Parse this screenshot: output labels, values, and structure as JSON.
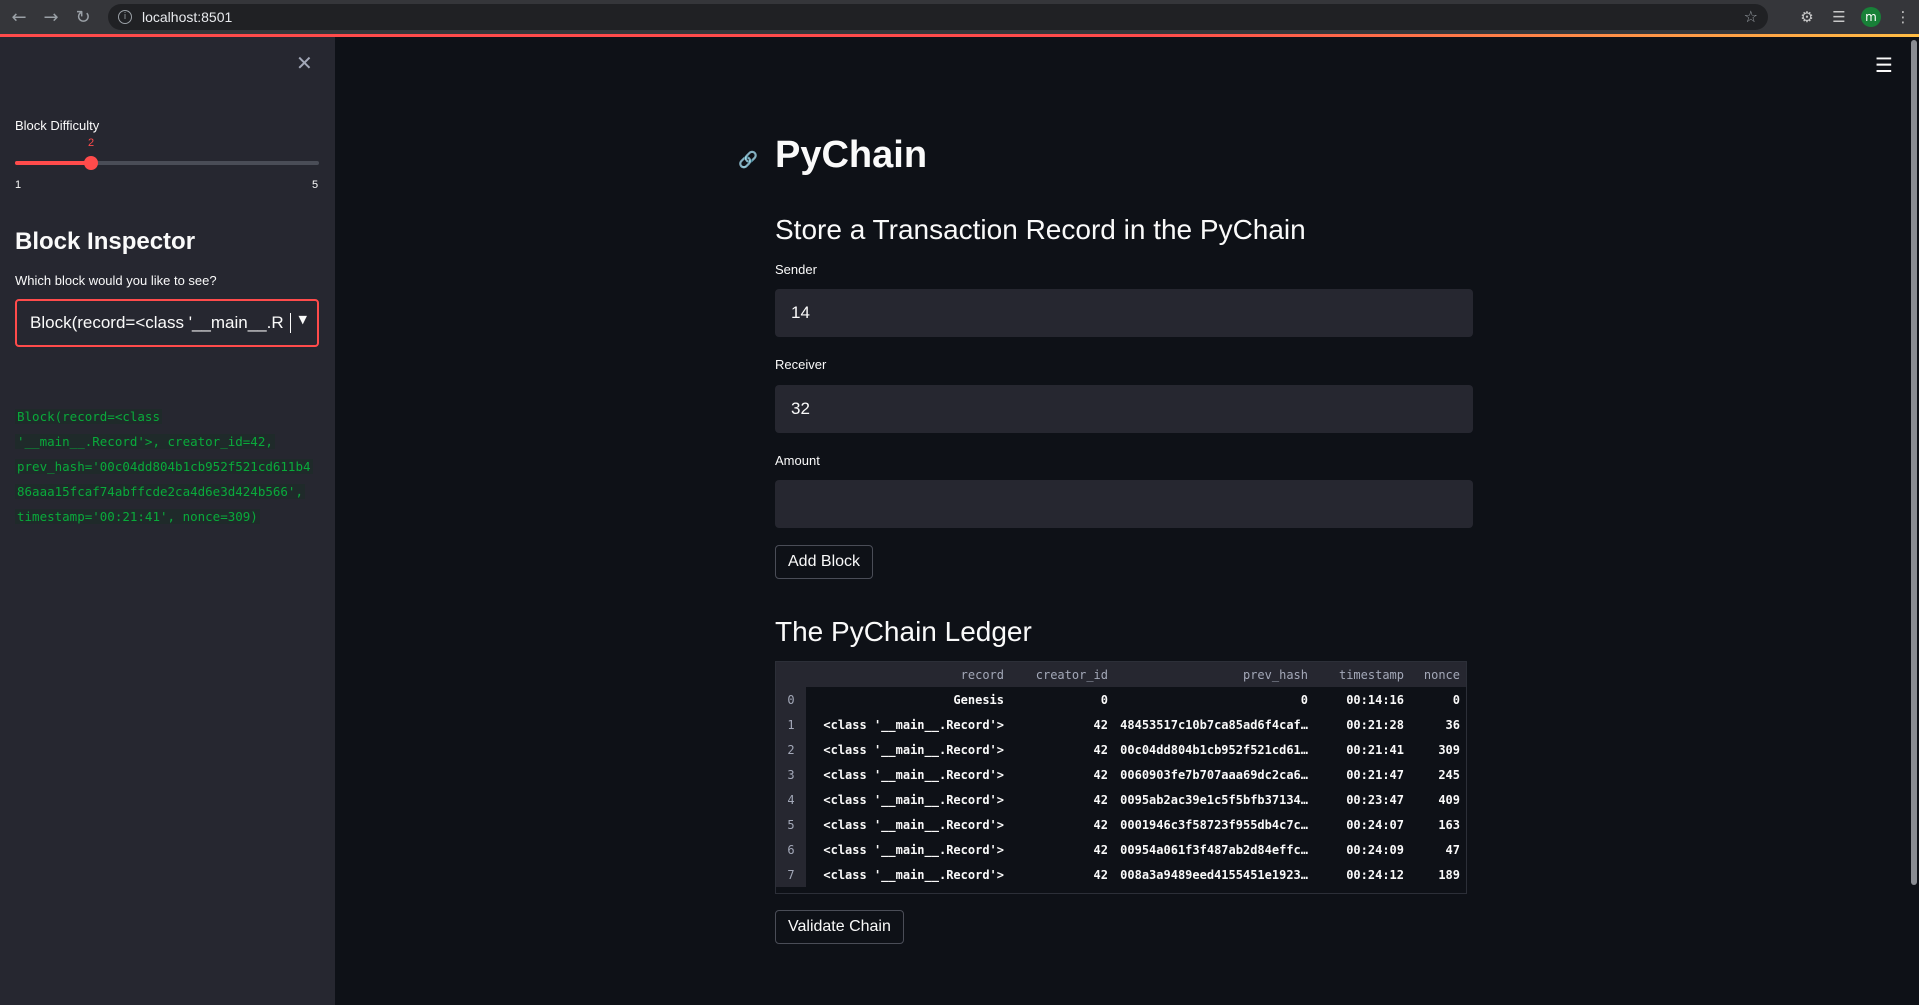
{
  "browser": {
    "url": "localhost:8501",
    "profile_initial": "m"
  },
  "sidebar": {
    "slider": {
      "label": "Block Difficulty",
      "value": "2",
      "min": "1",
      "max": "5",
      "fraction": 0.25
    },
    "heading": "Block Inspector",
    "select_label": "Which block would you like to see?",
    "select_value": "Block(record=<class '__main__.R...",
    "code_lines": [
      "Block(record=<class",
      "'__main__.Record'>, creator_id=42,",
      "prev_hash='00c04dd804b1cb952f521cd611b4",
      "86aaa15fcaf74abffcde2ca4d6e3d424b566',",
      "timestamp='00:21:41', nonce=309)"
    ]
  },
  "main": {
    "title": "PyChain",
    "form_heading": "Store a Transaction Record in the PyChain",
    "sender": {
      "label": "Sender",
      "value": "14"
    },
    "receiver": {
      "label": "Receiver",
      "value": "32"
    },
    "amount": {
      "label": "Amount",
      "value": ""
    },
    "add_block": "Add Block",
    "ledger_heading": "The PyChain Ledger",
    "validate": "Validate Chain"
  },
  "ledger": {
    "columns": [
      "record",
      "creator_id",
      "prev_hash",
      "timestamp",
      "nonce"
    ],
    "rows": [
      [
        "0",
        "Genesis",
        "0",
        "0",
        "00:14:16",
        "0"
      ],
      [
        "1",
        "<class '__main__.Record'>",
        "42",
        "48453517c10b7ca85ad6f4caf…",
        "00:21:28",
        "36"
      ],
      [
        "2",
        "<class '__main__.Record'>",
        "42",
        "00c04dd804b1cb952f521cd61…",
        "00:21:41",
        "309"
      ],
      [
        "3",
        "<class '__main__.Record'>",
        "42",
        "0060903fe7b707aaa69dc2ca6…",
        "00:21:47",
        "245"
      ],
      [
        "4",
        "<class '__main__.Record'>",
        "42",
        "0095ab2ac39e1c5f5bfb37134…",
        "00:23:47",
        "409"
      ],
      [
        "5",
        "<class '__main__.Record'>",
        "42",
        "0001946c3f58723f955db4c7c…",
        "00:24:07",
        "163"
      ],
      [
        "6",
        "<class '__main__.Record'>",
        "42",
        "00954a061f3f487ab2d84effc…",
        "00:24:09",
        "47"
      ],
      [
        "7",
        "<class '__main__.Record'>",
        "42",
        "008a3a9489eed4155451e1923…",
        "00:24:12",
        "189"
      ]
    ]
  }
}
